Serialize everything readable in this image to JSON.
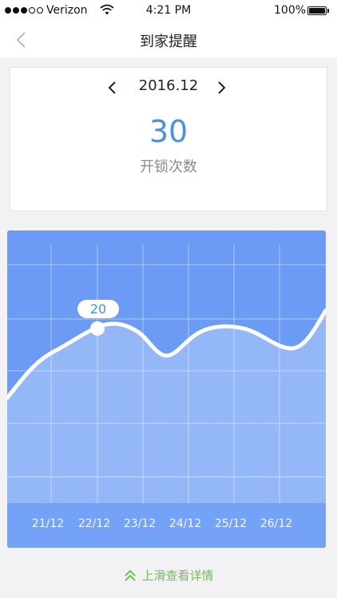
{
  "status_bar": {
    "carrier": "Verizon",
    "time": "4:21 PM",
    "battery": "100%",
    "signal_icon": "signal-dots-icon",
    "wifi_icon": "wifi-icon",
    "battery_icon": "battery-icon"
  },
  "nav": {
    "title": "到家提醒",
    "back_icon": "chevron-left-icon"
  },
  "summary": {
    "month": "2016.12",
    "count": "30",
    "count_label": "开锁次数"
  },
  "chart_data": {
    "type": "area",
    "x": [
      "21/12",
      "22/12",
      "23/12",
      "24/12",
      "25/12",
      "26/12"
    ],
    "highlight": {
      "x": "22/12",
      "label": "20"
    }
  },
  "footer": {
    "label": "上滑查看详情",
    "icon": "double-chevron-up-icon"
  },
  "colors": {
    "accent_blue": "#4a90e2",
    "chart_bg": "#6b9bf5",
    "footer_green": "#6cc24a"
  }
}
